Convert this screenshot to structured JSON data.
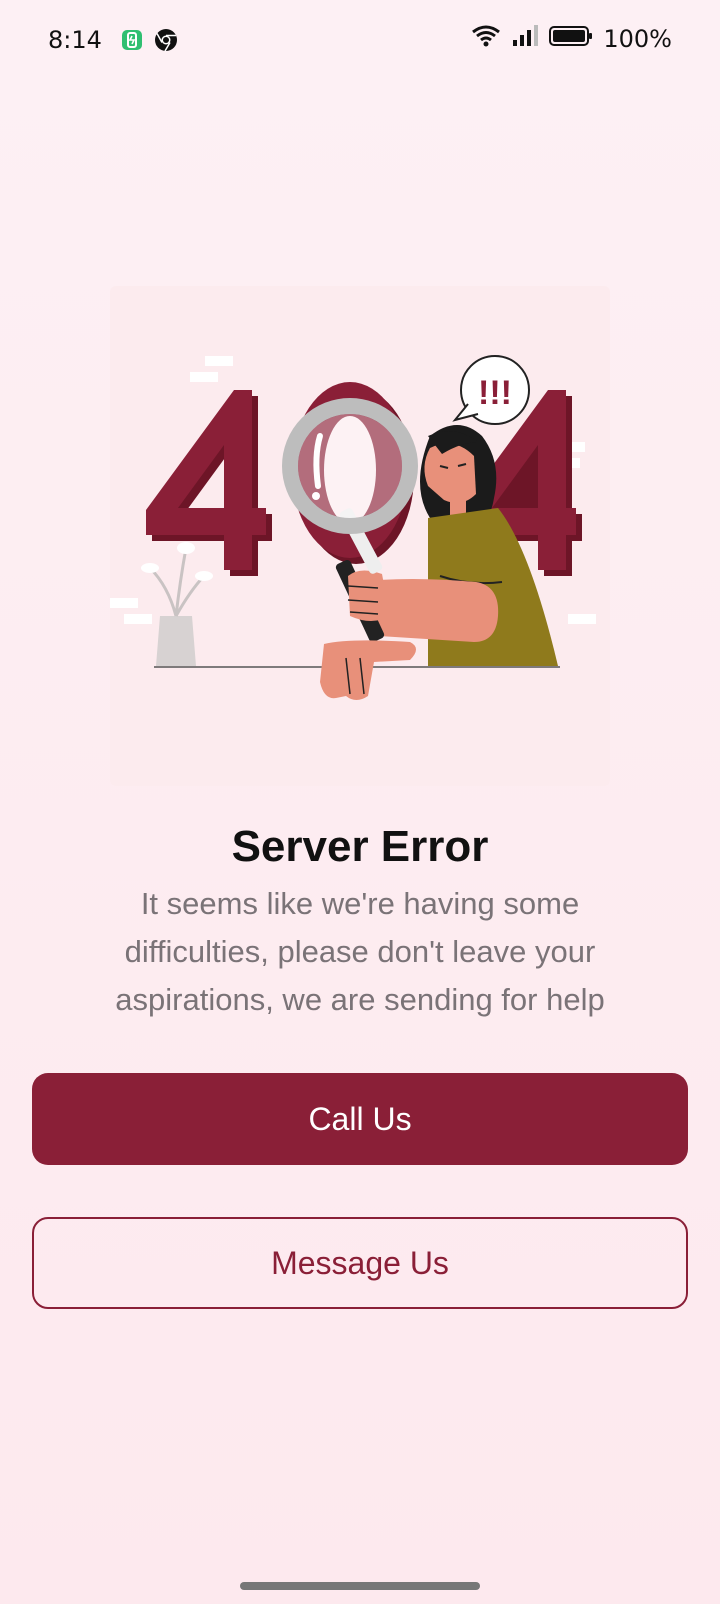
{
  "status_bar": {
    "time": "8:14",
    "battery_percent": "100%",
    "icons_left": [
      "battery-saver-icon",
      "chrome-icon"
    ],
    "icons_right": [
      "wifi-icon",
      "signal-icon",
      "battery-icon"
    ]
  },
  "illustration": {
    "number_text": "404",
    "speech_text": "!!!",
    "colors": {
      "primary": "#8a1f37",
      "skin": "#e8907a",
      "shirt": "#8f7a1c"
    }
  },
  "content": {
    "title": "Server Error",
    "description": "It seems like we're having some difficulties, please don't leave your aspirations, we are sending for help"
  },
  "actions": {
    "call_label": "Call Us",
    "message_label": "Message Us"
  },
  "colors": {
    "accent": "#8a1f37",
    "background": "#fdeef2"
  }
}
